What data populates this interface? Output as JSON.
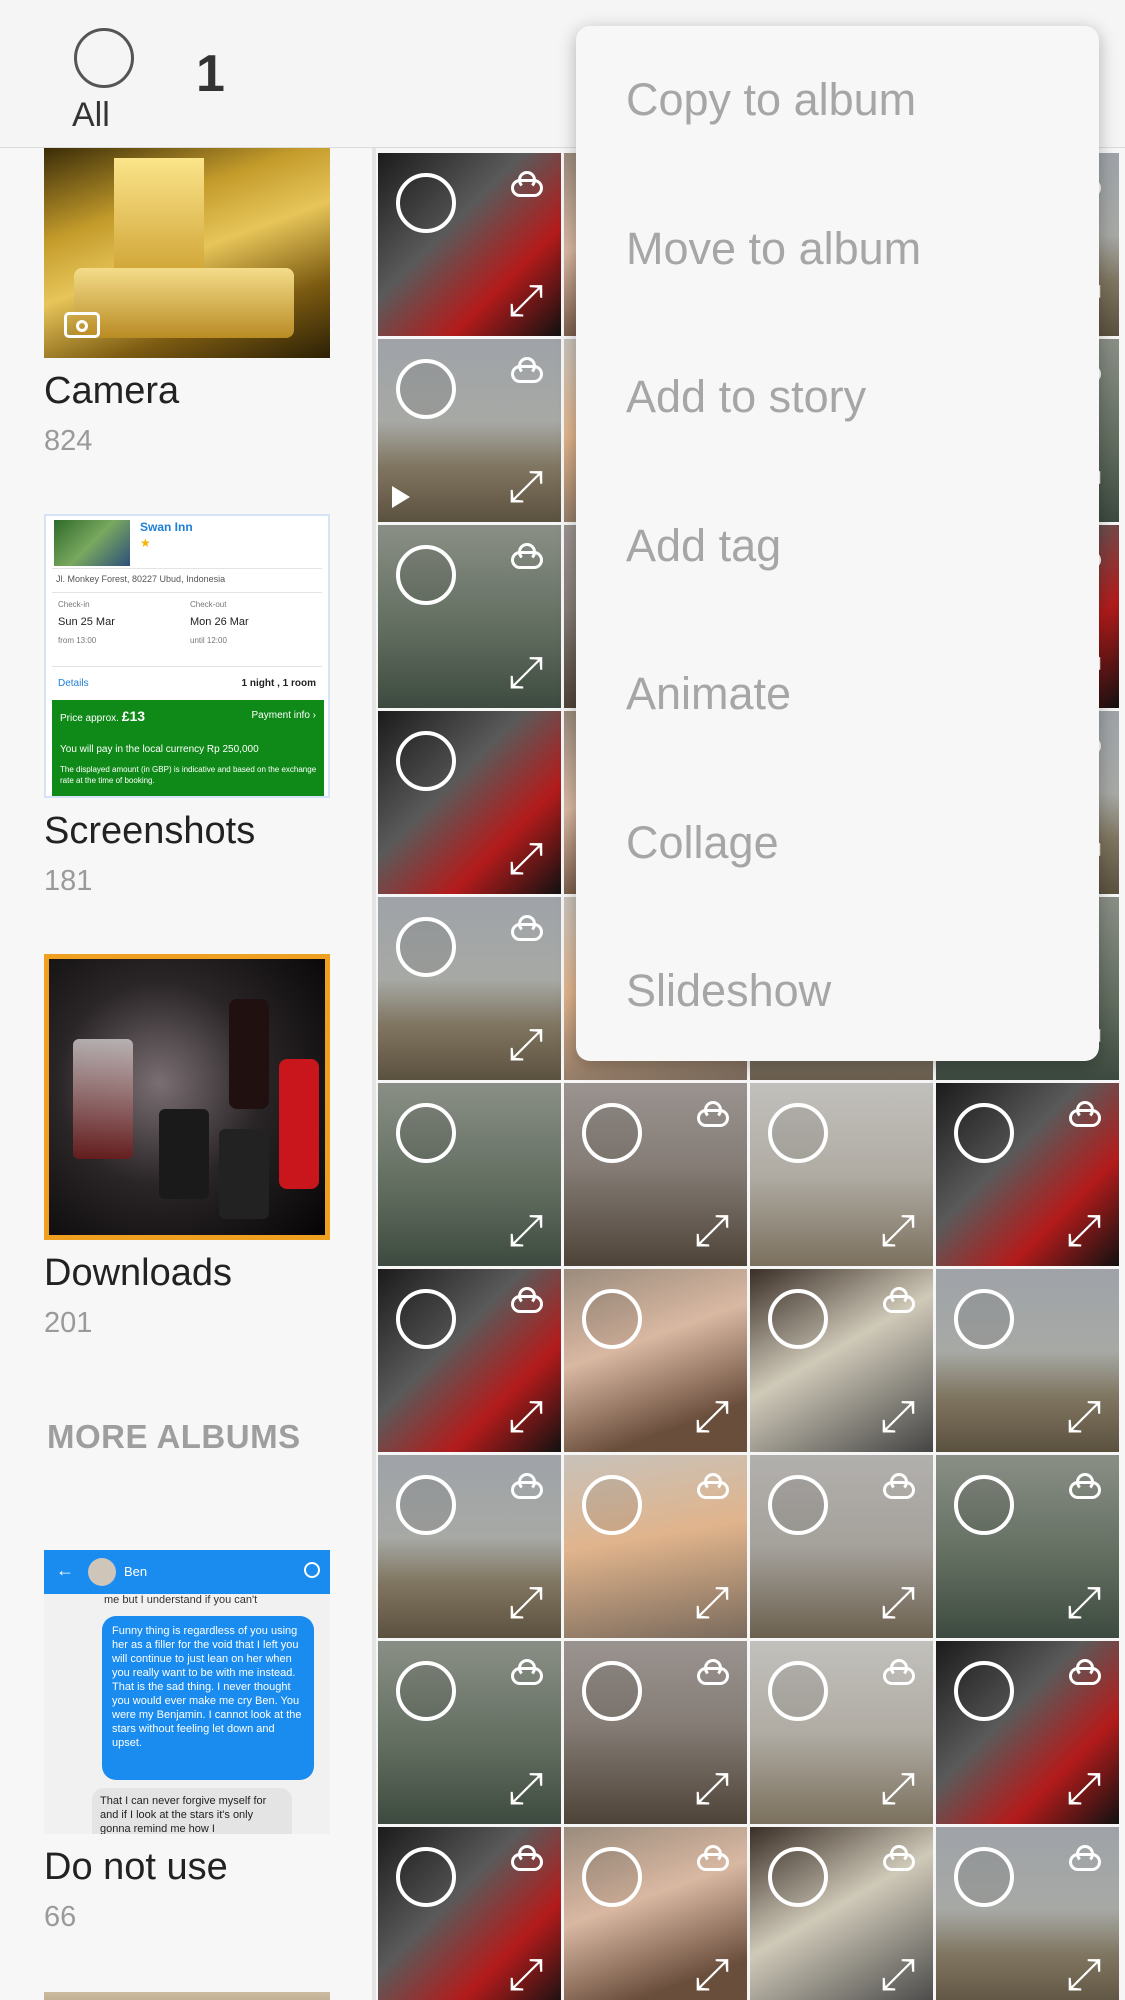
{
  "topbar": {
    "all_label": "All",
    "selected_count": "1"
  },
  "albums": [
    {
      "name": "Camera",
      "count": "824"
    },
    {
      "name": "Screenshots",
      "count": "181"
    },
    {
      "name": "Downloads",
      "count": "201"
    },
    {
      "name": "Do not use",
      "count": "66"
    }
  ],
  "more_albums_label": "MORE ALBUMS",
  "screenshot_thumb": {
    "hotel": "Swan Inn",
    "star": "★",
    "address": "Jl. Monkey Forest, 80227 Ubud, Indonesia",
    "checkin_label": "Check-in",
    "checkin_date": "Sun 25 Mar",
    "checkin_time": "from 13:00",
    "checkout_label": "Check-out",
    "checkout_date": "Mon 26 Mar",
    "checkout_time": "until 12:00",
    "details": "Details",
    "nights": "1 night , 1 room",
    "price_label": "Price approx.",
    "price": "£13",
    "payment_info": "Payment info ›",
    "local_currency": "You will pay in the local currency Rp 250,000",
    "disclaimer": "The displayed amount (in GBP) is indicative and based on the exchange rate at the time of booking."
  },
  "chat_thumb": {
    "name": "Ben",
    "top_line": "me but I understand if you can't",
    "blue_message": "Funny thing is regardless of you using her as a filler for the void that I left you will continue to just lean on her when you really want to be with me instead. That is the sad thing. I never thought you would ever make me cry Ben. You were my Benjamin. I cannot look at the stars without feeling let down and upset.",
    "gray_message": "That I can never forgive myself for and if I look at the stars it's only gonna remind me how I"
  },
  "context_menu": {
    "items": [
      "Copy to album",
      "Move to album",
      "Add to story",
      "Add tag",
      "Animate",
      "Collage",
      "Slideshow"
    ]
  },
  "colors": {
    "selection_border": "#f0a020",
    "menu_text": "#a6a6a6",
    "chat_blue": "#1a8cf0",
    "booking_green": "#0f8a18"
  }
}
